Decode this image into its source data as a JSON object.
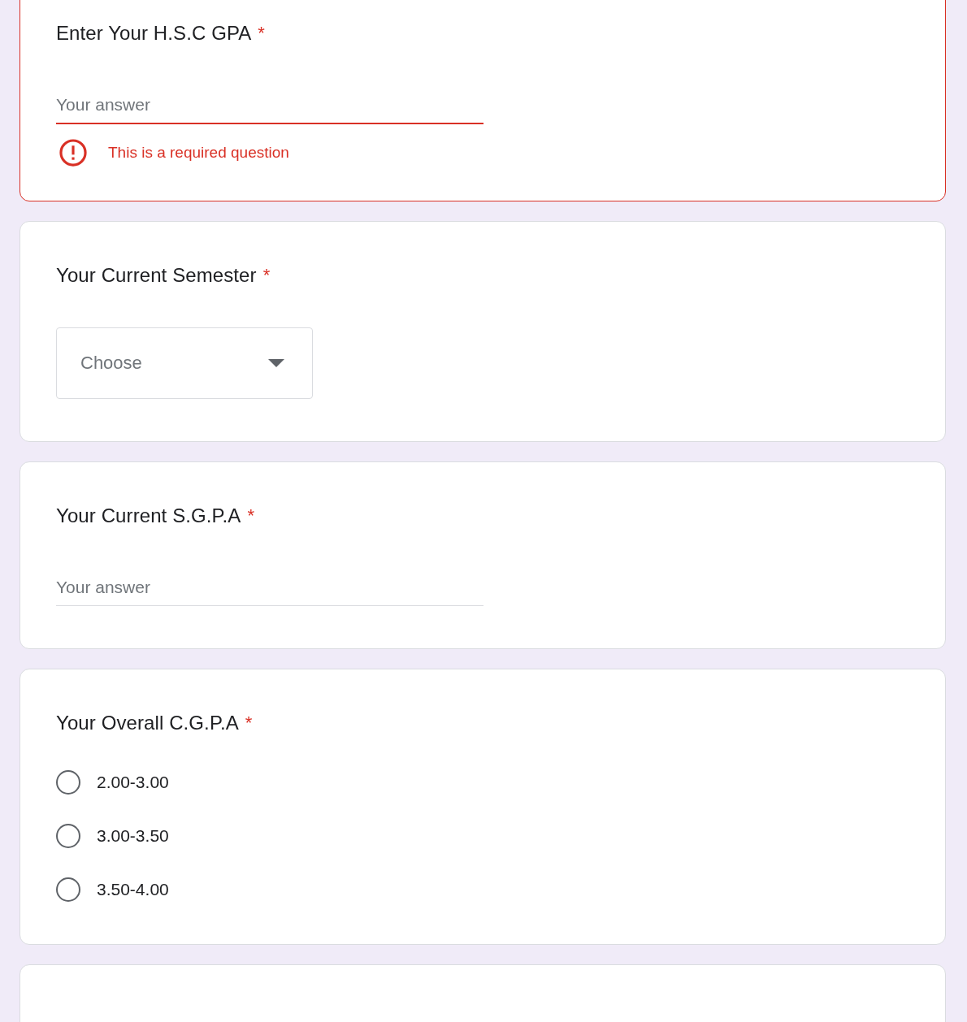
{
  "questions": [
    {
      "kind": "text",
      "title": "Enter Your H.S.C GPA",
      "required_mark": "*",
      "placeholder": "Your answer",
      "error": "This is a required question"
    },
    {
      "kind": "dropdown",
      "title": "Your Current Semester",
      "required_mark": "*",
      "placeholder": "Choose"
    },
    {
      "kind": "text",
      "title": "Your Current S.G.P.A",
      "required_mark": "*",
      "placeholder": "Your answer"
    },
    {
      "kind": "radio",
      "title": "Your Overall C.G.P.A",
      "required_mark": "*",
      "options": [
        {
          "label": "2.00-3.00",
          "selected": false
        },
        {
          "label": "3.00-3.50",
          "selected": false
        },
        {
          "label": "3.50-4.00",
          "selected": false
        }
      ]
    },
    {
      "kind": "blank"
    }
  ]
}
